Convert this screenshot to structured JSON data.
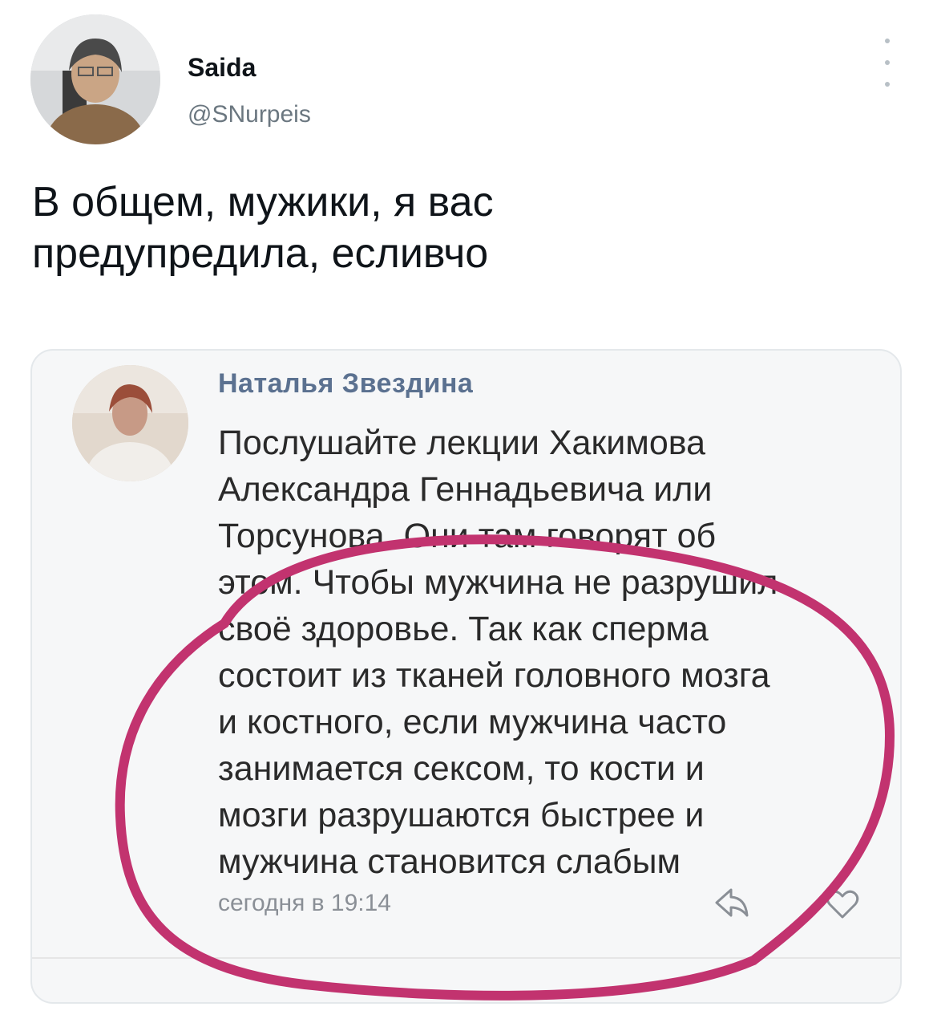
{
  "tweet": {
    "author": {
      "name": "Saida",
      "handle": "@SNurpeis"
    },
    "text_lines": [
      "В общем, мужики, я вас",
      "предупредила, есливчо"
    ]
  },
  "embedded_post": {
    "author": "Наталья Звездина",
    "text_lines": [
      "Послушайте лекции Хакимова",
      "Александра Геннадьевича или",
      "Торсунова. Они там говорят об",
      "этом. Чтобы мужчина не разрушил",
      "своё здоровье. Так как сперма",
      "состоит из тканей головного мозга",
      "и костного, если мужчина часто",
      "занимается сексом, то кости и",
      "мозги разрушаются быстрее и",
      "мужчина становится слабым"
    ],
    "timestamp": "сегодня в 19:14"
  },
  "colors": {
    "circle": "#c2336f",
    "vk_name": "#5b7190",
    "handle": "#6b7780"
  },
  "icons": [
    "more-icon",
    "share-icon",
    "heart-icon"
  ]
}
